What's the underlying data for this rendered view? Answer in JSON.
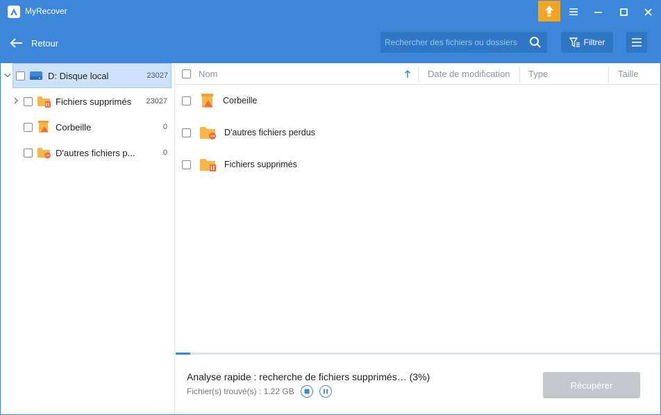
{
  "app": {
    "title": "MyRecover"
  },
  "header": {
    "back_label": "Retour",
    "search_placeholder": "Rechercher des fichiers ou dossiers",
    "filter_label": "Filtrer"
  },
  "sidebar": {
    "drive": {
      "label": "D: Disque local",
      "count": "23027"
    },
    "items": [
      {
        "label": "Fichiers supprimés",
        "count": "23027",
        "icon": "folder-deleted-icon"
      },
      {
        "label": "Corbeille",
        "count": "0",
        "icon": "recycle-bin-icon"
      },
      {
        "label": "D'autres fichiers p...",
        "count": "0",
        "icon": "folder-lost-icon"
      }
    ]
  },
  "list": {
    "columns": [
      "Nom",
      "Date de modification",
      "Type",
      "Taille"
    ],
    "rows": [
      {
        "name": "Corbeille",
        "icon": "recycle-bin-icon"
      },
      {
        "name": "D'autres fichiers perdus",
        "icon": "folder-lost-icon"
      },
      {
        "name": "Fichiers supprimés",
        "icon": "folder-deleted-icon"
      }
    ]
  },
  "footer": {
    "status": "Analyse rapide : recherche de fichiers supprimés… (3%)",
    "progress": 0.03,
    "found": "Fichier(s) trouvé(s) : 1.22 GB",
    "recover_label": "Récupérer"
  },
  "colors": {
    "header": "#3c87d9",
    "upgrade": "#f6a41f",
    "folder": "#f7b54a",
    "badge": "#f26b3a"
  }
}
